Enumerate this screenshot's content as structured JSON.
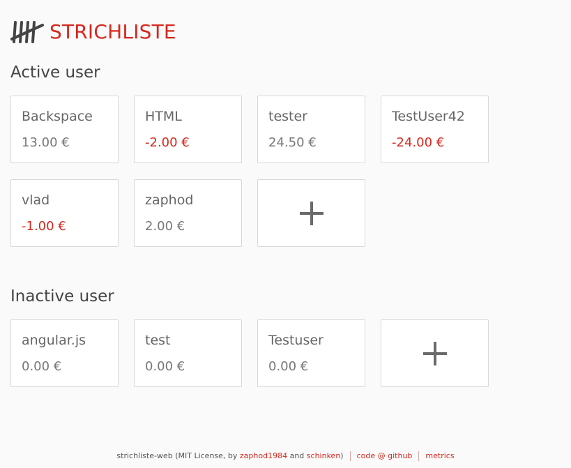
{
  "app": {
    "title": "STRICHLISTE"
  },
  "sections": {
    "active_title": "Active user",
    "inactive_title": "Inactive user"
  },
  "active_users": [
    {
      "name": "Backspace",
      "balance": "13.00 €"
    },
    {
      "name": "HTML",
      "balance": "-2.00 €"
    },
    {
      "name": "tester",
      "balance": "24.50 €"
    },
    {
      "name": "TestUser42",
      "balance": "-24.00 €"
    },
    {
      "name": "vlad",
      "balance": "-1.00 €"
    },
    {
      "name": "zaphod",
      "balance": "2.00 €"
    }
  ],
  "inactive_users": [
    {
      "name": "angular.js",
      "balance": "0.00 €"
    },
    {
      "name": "test",
      "balance": "0.00 €"
    },
    {
      "name": "Testuser",
      "balance": "0.00 €"
    }
  ],
  "footer": {
    "prefix": "strichliste-web (MIT License, by ",
    "author1": "zaphod1984",
    "and": " and ",
    "author2": "schinken",
    "suffix": ")",
    "code_link": "code @ github",
    "metrics_link": "metrics"
  },
  "colors": {
    "accent": "#d6281e",
    "negative": "#d6281e",
    "background": "#fafafa",
    "card_border": "#d8d8d8"
  },
  "icons": {
    "logo": "tally-marks-icon",
    "add": "plus-icon"
  }
}
